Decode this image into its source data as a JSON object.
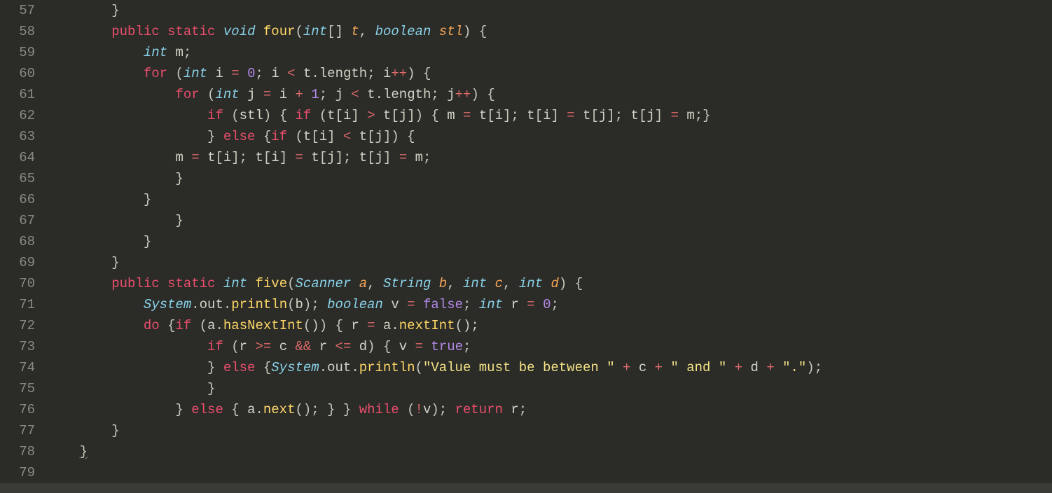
{
  "startLine": 57,
  "lineNumbers": [
    "57",
    "58",
    "59",
    "60",
    "61",
    "62",
    "63",
    "64",
    "65",
    "66",
    "67",
    "68",
    "69",
    "70",
    "71",
    "72",
    "73",
    "74",
    "75",
    "76",
    "77",
    "78",
    "79"
  ],
  "lines": [
    [
      [
        "        ",
        "punc"
      ],
      [
        "}",
        "punc"
      ]
    ],
    [
      [
        "        ",
        ""
      ],
      [
        "public",
        "kw"
      ],
      [
        " ",
        ""
      ],
      [
        "static",
        "kw"
      ],
      [
        " ",
        ""
      ],
      [
        "void",
        "typ"
      ],
      [
        " ",
        ""
      ],
      [
        "four",
        "fn"
      ],
      [
        "(",
        "punc"
      ],
      [
        "int",
        "typ"
      ],
      [
        "[] ",
        "punc"
      ],
      [
        "t",
        "par"
      ],
      [
        ", ",
        "punc"
      ],
      [
        "boolean",
        "typ"
      ],
      [
        " ",
        ""
      ],
      [
        "stl",
        "par"
      ],
      [
        ") {",
        "punc"
      ]
    ],
    [
      [
        "            ",
        ""
      ],
      [
        "int",
        "typ"
      ],
      [
        " ",
        ""
      ],
      [
        "m",
        "var"
      ],
      [
        ";",
        "punc"
      ]
    ],
    [
      [
        "            ",
        ""
      ],
      [
        "for",
        "kw"
      ],
      [
        " (",
        "punc"
      ],
      [
        "int",
        "typ"
      ],
      [
        " ",
        ""
      ],
      [
        "i",
        "var"
      ],
      [
        " ",
        ""
      ],
      [
        "=",
        "op"
      ],
      [
        " ",
        ""
      ],
      [
        "0",
        "num"
      ],
      [
        "; ",
        "punc"
      ],
      [
        "i",
        "var"
      ],
      [
        " ",
        ""
      ],
      [
        "<",
        "op"
      ],
      [
        " ",
        ""
      ],
      [
        "t",
        "var"
      ],
      [
        ".",
        "punc"
      ],
      [
        "length",
        "var"
      ],
      [
        "; ",
        "punc"
      ],
      [
        "i",
        "var"
      ],
      [
        "++",
        "op"
      ],
      [
        ") {",
        "punc"
      ]
    ],
    [
      [
        "                ",
        ""
      ],
      [
        "for",
        "kw"
      ],
      [
        " (",
        "punc"
      ],
      [
        "int",
        "typ"
      ],
      [
        " ",
        ""
      ],
      [
        "j",
        "var"
      ],
      [
        " ",
        ""
      ],
      [
        "=",
        "op"
      ],
      [
        " ",
        ""
      ],
      [
        "i",
        "var"
      ],
      [
        " ",
        ""
      ],
      [
        "+",
        "op"
      ],
      [
        " ",
        ""
      ],
      [
        "1",
        "num"
      ],
      [
        "; ",
        "punc"
      ],
      [
        "j",
        "var"
      ],
      [
        " ",
        ""
      ],
      [
        "<",
        "op"
      ],
      [
        " ",
        ""
      ],
      [
        "t",
        "var"
      ],
      [
        ".",
        "punc"
      ],
      [
        "length",
        "var"
      ],
      [
        "; ",
        "punc"
      ],
      [
        "j",
        "var"
      ],
      [
        "++",
        "op"
      ],
      [
        ") {",
        "punc"
      ]
    ],
    [
      [
        "                    ",
        ""
      ],
      [
        "if",
        "kw"
      ],
      [
        " (",
        "punc"
      ],
      [
        "stl",
        "var"
      ],
      [
        ") { ",
        "punc"
      ],
      [
        "if",
        "kw"
      ],
      [
        " (",
        "punc"
      ],
      [
        "t",
        "var"
      ],
      [
        "[",
        "punc"
      ],
      [
        "i",
        "var"
      ],
      [
        "] ",
        "punc"
      ],
      [
        ">",
        "op"
      ],
      [
        " ",
        ""
      ],
      [
        "t",
        "var"
      ],
      [
        "[",
        "punc"
      ],
      [
        "j",
        "var"
      ],
      [
        "]) { ",
        "punc"
      ],
      [
        "m",
        "var"
      ],
      [
        " ",
        ""
      ],
      [
        "=",
        "op"
      ],
      [
        " ",
        ""
      ],
      [
        "t",
        "var"
      ],
      [
        "[",
        "punc"
      ],
      [
        "i",
        "var"
      ],
      [
        "]; ",
        "punc"
      ],
      [
        "t",
        "var"
      ],
      [
        "[",
        "punc"
      ],
      [
        "i",
        "var"
      ],
      [
        "] ",
        "punc"
      ],
      [
        "=",
        "op"
      ],
      [
        " ",
        ""
      ],
      [
        "t",
        "var"
      ],
      [
        "[",
        "punc"
      ],
      [
        "j",
        "var"
      ],
      [
        "]; ",
        "punc"
      ],
      [
        "t",
        "var"
      ],
      [
        "[",
        "punc"
      ],
      [
        "j",
        "var"
      ],
      [
        "] ",
        "punc"
      ],
      [
        "=",
        "op"
      ],
      [
        " ",
        ""
      ],
      [
        "m",
        "var"
      ],
      [
        ";}",
        "punc"
      ]
    ],
    [
      [
        "                    } ",
        "punc"
      ],
      [
        "else",
        "kw"
      ],
      [
        " {",
        "punc"
      ],
      [
        "if",
        "kw"
      ],
      [
        " (",
        "punc"
      ],
      [
        "t",
        "var"
      ],
      [
        "[",
        "punc"
      ],
      [
        "i",
        "var"
      ],
      [
        "] ",
        "punc"
      ],
      [
        "<",
        "op"
      ],
      [
        " ",
        ""
      ],
      [
        "t",
        "var"
      ],
      [
        "[",
        "punc"
      ],
      [
        "j",
        "var"
      ],
      [
        "]) {",
        "punc"
      ]
    ],
    [
      [
        "                ",
        ""
      ],
      [
        "m",
        "var"
      ],
      [
        " ",
        ""
      ],
      [
        "=",
        "op"
      ],
      [
        " ",
        ""
      ],
      [
        "t",
        "var"
      ],
      [
        "[",
        "punc"
      ],
      [
        "i",
        "var"
      ],
      [
        "]; ",
        "punc"
      ],
      [
        "t",
        "var"
      ],
      [
        "[",
        "punc"
      ],
      [
        "i",
        "var"
      ],
      [
        "] ",
        "punc"
      ],
      [
        "=",
        "op"
      ],
      [
        " ",
        ""
      ],
      [
        "t",
        "var"
      ],
      [
        "[",
        "punc"
      ],
      [
        "j",
        "var"
      ],
      [
        "]; ",
        "punc"
      ],
      [
        "t",
        "var"
      ],
      [
        "[",
        "punc"
      ],
      [
        "j",
        "var"
      ],
      [
        "] ",
        "punc"
      ],
      [
        "=",
        "op"
      ],
      [
        " ",
        ""
      ],
      [
        "m",
        "var"
      ],
      [
        ";",
        "punc"
      ]
    ],
    [
      [
        "                }",
        "punc"
      ]
    ],
    [
      [
        "            }",
        "punc"
      ]
    ],
    [
      [
        "                }",
        "punc"
      ]
    ],
    [
      [
        "            }",
        "punc"
      ]
    ],
    [
      [
        "        }",
        "punc"
      ]
    ],
    [
      [
        "        ",
        ""
      ],
      [
        "public",
        "kw"
      ],
      [
        " ",
        ""
      ],
      [
        "static",
        "kw"
      ],
      [
        " ",
        ""
      ],
      [
        "int",
        "typ"
      ],
      [
        " ",
        ""
      ],
      [
        "five",
        "fn"
      ],
      [
        "(",
        "punc"
      ],
      [
        "Scanner",
        "typ"
      ],
      [
        " ",
        ""
      ],
      [
        "a",
        "par"
      ],
      [
        ", ",
        "punc"
      ],
      [
        "String",
        "typ"
      ],
      [
        " ",
        ""
      ],
      [
        "b",
        "par"
      ],
      [
        ", ",
        "punc"
      ],
      [
        "int",
        "typ"
      ],
      [
        " ",
        ""
      ],
      [
        "c",
        "par"
      ],
      [
        ", ",
        "punc"
      ],
      [
        "int",
        "typ"
      ],
      [
        " ",
        ""
      ],
      [
        "d",
        "par"
      ],
      [
        ") {",
        "punc"
      ]
    ],
    [
      [
        "            ",
        ""
      ],
      [
        "System",
        "sys"
      ],
      [
        ".",
        "punc"
      ],
      [
        "out",
        "mem"
      ],
      [
        ".",
        "punc"
      ],
      [
        "println",
        "fn"
      ],
      [
        "(",
        "punc"
      ],
      [
        "b",
        "var"
      ],
      [
        "); ",
        "punc"
      ],
      [
        "boolean",
        "typ"
      ],
      [
        " ",
        ""
      ],
      [
        "v",
        "var"
      ],
      [
        " ",
        ""
      ],
      [
        "=",
        "op"
      ],
      [
        " ",
        ""
      ],
      [
        "false",
        "bool"
      ],
      [
        "; ",
        "punc"
      ],
      [
        "int",
        "typ"
      ],
      [
        " ",
        ""
      ],
      [
        "r",
        "var"
      ],
      [
        " ",
        ""
      ],
      [
        "=",
        "op"
      ],
      [
        " ",
        ""
      ],
      [
        "0",
        "num"
      ],
      [
        ";",
        "punc"
      ]
    ],
    [
      [
        "            ",
        ""
      ],
      [
        "do",
        "kw"
      ],
      [
        " {",
        "punc"
      ],
      [
        "if",
        "kw"
      ],
      [
        " (",
        "punc"
      ],
      [
        "a",
        "var"
      ],
      [
        ".",
        "punc"
      ],
      [
        "hasNextInt",
        "fn"
      ],
      [
        "()) { ",
        "punc"
      ],
      [
        "r",
        "var"
      ],
      [
        " ",
        ""
      ],
      [
        "=",
        "op"
      ],
      [
        " ",
        ""
      ],
      [
        "a",
        "var"
      ],
      [
        ".",
        "punc"
      ],
      [
        "nextInt",
        "fn"
      ],
      [
        "();",
        "punc"
      ]
    ],
    [
      [
        "                    ",
        ""
      ],
      [
        "if",
        "kw"
      ],
      [
        " (",
        "punc"
      ],
      [
        "r",
        "var"
      ],
      [
        " ",
        ""
      ],
      [
        ">=",
        "op"
      ],
      [
        " ",
        ""
      ],
      [
        "c",
        "var"
      ],
      [
        " ",
        ""
      ],
      [
        "&&",
        "op"
      ],
      [
        " ",
        ""
      ],
      [
        "r",
        "var"
      ],
      [
        " ",
        ""
      ],
      [
        "<=",
        "op"
      ],
      [
        " ",
        ""
      ],
      [
        "d",
        "var"
      ],
      [
        ") { ",
        "punc"
      ],
      [
        "v",
        "var"
      ],
      [
        " ",
        ""
      ],
      [
        "=",
        "op"
      ],
      [
        " ",
        ""
      ],
      [
        "true",
        "bool"
      ],
      [
        ";",
        "punc"
      ]
    ],
    [
      [
        "                    } ",
        "punc"
      ],
      [
        "else",
        "kw"
      ],
      [
        " {",
        "punc"
      ],
      [
        "System",
        "sys"
      ],
      [
        ".",
        "punc"
      ],
      [
        "out",
        "mem"
      ],
      [
        ".",
        "punc"
      ],
      [
        "println",
        "fn"
      ],
      [
        "(",
        "punc"
      ],
      [
        "\"Value must be between \"",
        "str"
      ],
      [
        " ",
        ""
      ],
      [
        "+",
        "op"
      ],
      [
        " ",
        ""
      ],
      [
        "c",
        "var"
      ],
      [
        " ",
        ""
      ],
      [
        "+",
        "op"
      ],
      [
        " ",
        ""
      ],
      [
        "\" and \"",
        "str"
      ],
      [
        " ",
        ""
      ],
      [
        "+",
        "op"
      ],
      [
        " ",
        ""
      ],
      [
        "d",
        "var"
      ],
      [
        " ",
        ""
      ],
      [
        "+",
        "op"
      ],
      [
        " ",
        ""
      ],
      [
        "\".\"",
        "str"
      ],
      [
        ");",
        "punc"
      ]
    ],
    [
      [
        "                    }",
        "punc"
      ]
    ],
    [
      [
        "                } ",
        "punc"
      ],
      [
        "else",
        "kw"
      ],
      [
        " { ",
        "punc"
      ],
      [
        "a",
        "var"
      ],
      [
        ".",
        "punc"
      ],
      [
        "next",
        "fn"
      ],
      [
        "(); } } ",
        "punc"
      ],
      [
        "while",
        "kw"
      ],
      [
        " (",
        "punc"
      ],
      [
        "!",
        "op"
      ],
      [
        "v",
        "var"
      ],
      [
        "); ",
        "punc"
      ],
      [
        "return",
        "kw"
      ],
      [
        " ",
        ""
      ],
      [
        "r",
        "var"
      ],
      [
        ";",
        "punc"
      ]
    ],
    [
      [
        "        }",
        "punc"
      ]
    ],
    [
      [
        "    ",
        ""
      ],
      [
        "}",
        "punc underline"
      ]
    ],
    [
      [
        "",
        ""
      ]
    ]
  ]
}
